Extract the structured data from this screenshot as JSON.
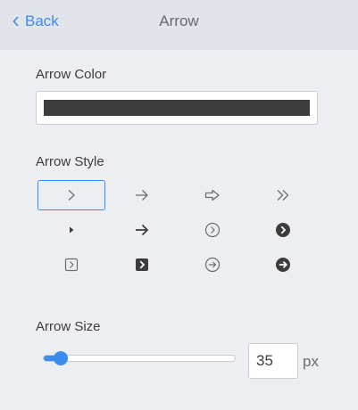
{
  "header": {
    "back_label": "Back",
    "back_icon": "chevron-left-icon",
    "title": "Arrow"
  },
  "arrow_color": {
    "label": "Arrow Color",
    "value": "#3c3c3c"
  },
  "arrow_style": {
    "label": "Arrow Style",
    "selected": "chevron-right",
    "options": [
      "chevron-right",
      "thin-arrow-right",
      "outline-block-arrow-right",
      "double-chevron-right",
      "triangle-right",
      "bold-arrow-right",
      "circle-outline-chevron-right",
      "circle-filled-chevron-right",
      "square-outline-chevron-right",
      "square-filled-chevron-right",
      "circle-outline-arrow-right",
      "circle-filled-arrow-right"
    ]
  },
  "arrow_size": {
    "label": "Arrow Size",
    "value": "35",
    "unit": "px",
    "slider_fraction": 0.06
  },
  "colors": {
    "accent": "#3b8cf0",
    "icon": "#6a6e74",
    "icon_dark": "#3c3c3c"
  }
}
